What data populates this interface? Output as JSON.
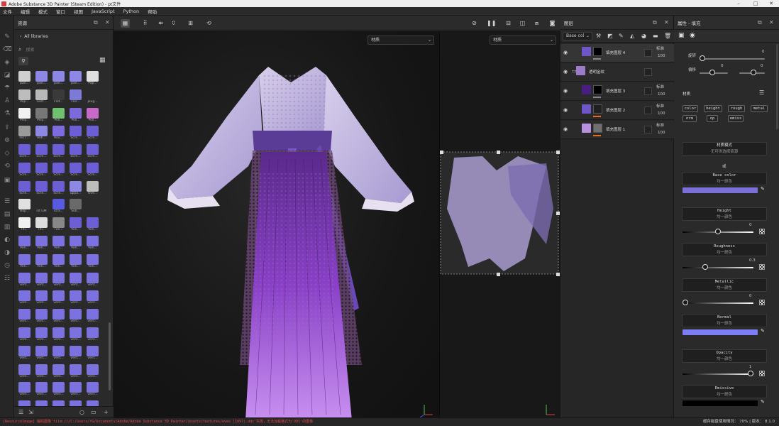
{
  "window": {
    "title": "Adobe Substance 3D Painter (Steam Edition) - pt文件",
    "min": "–",
    "max": "□",
    "close": "✕"
  },
  "menu": [
    "文件",
    "编辑",
    "模式",
    "窗口",
    "视图",
    "JavaScript",
    "Python",
    "帮助"
  ],
  "assets": {
    "title": "资源",
    "library": "All libraries",
    "search_placeholder": "搜索",
    "thumbs": [
      {
        "label": "pan...",
        "color": "#cfcfcf"
      },
      {
        "label": "pan...",
        "color": "#8d87e6"
      },
      {
        "label": "pan...",
        "color": "#8d87e6"
      },
      {
        "label": "pan...",
        "color": "#8d87e6"
      },
      {
        "label": "Pap...",
        "color": "#e0e0e0"
      },
      {
        "label": "Pap...",
        "color": "#bdbdbd"
      },
      {
        "label": "Fent...",
        "color": "#b8b8b8"
      },
      {
        "label": "Flat...",
        "color": "#3a3a3a"
      },
      {
        "label": "Flor...",
        "color": "#7c7ad8"
      },
      {
        "label": "plug...",
        "color": "#2a2a2a"
      },
      {
        "label": "Poly...",
        "color": "#f2f2f2"
      },
      {
        "label": "Poly...",
        "color": "#777777"
      },
      {
        "label": "Poli...",
        "color": "#6fc06f"
      },
      {
        "label": "Poli...",
        "color": "#7a6adb"
      },
      {
        "label": "Poli...",
        "color": "#c76ac7"
      },
      {
        "label": "rec7...",
        "color": "#9a9a9a"
      },
      {
        "label": "redl...",
        "color": "#8d87e6"
      },
      {
        "label": "Rou...",
        "color": "#7e6be0"
      },
      {
        "label": "Scre...",
        "color": "#6c5fd6"
      },
      {
        "label": "Scre...",
        "color": "#6c5fd6"
      },
      {
        "label": "Scre...",
        "color": "#6c5fd6"
      },
      {
        "label": "Scre...",
        "color": "#6c5fd6"
      },
      {
        "label": "Scre...",
        "color": "#6c5fd6"
      },
      {
        "label": "Scre...",
        "color": "#6c5fd6"
      },
      {
        "label": "Scre...",
        "color": "#6c5fd6"
      },
      {
        "label": "Scre...",
        "color": "#6c5fd6"
      },
      {
        "label": "Scre...",
        "color": "#6c5fd6"
      },
      {
        "label": "Scre...",
        "color": "#6c5fd6"
      },
      {
        "label": "Scre...",
        "color": "#6c5fd6"
      },
      {
        "label": "Scre...",
        "color": "#6c5fd6"
      },
      {
        "label": "Scre...",
        "color": "#6c5fd6"
      },
      {
        "label": "Scre...",
        "color": "#6c5fd6"
      },
      {
        "label": "Scre...",
        "color": "#6c5fd6"
      },
      {
        "label": "uppa...",
        "color": "#8d87e6"
      },
      {
        "label": "Ove...",
        "color": "#bdbdbd"
      },
      {
        "label": "slop...",
        "color": "#e0e0e0"
      },
      {
        "label": "slt GM",
        "color": "#2a2a2a"
      },
      {
        "label": "stra...",
        "color": "#5a5ae0"
      },
      {
        "label": "Sub...",
        "color": "#6a6a6a"
      },
      {
        "label": "",
        "color": "#2a2a2a"
      },
      {
        "label": "Thi...",
        "color": "#f0f0f0"
      },
      {
        "label": "Thi...",
        "color": "#dcdcdc"
      },
      {
        "label": "Tile...",
        "color": "#888888"
      },
      {
        "label": "Ven...",
        "color": "#6c5fd6"
      },
      {
        "label": "Ven...",
        "color": "#6c5fd6"
      },
      {
        "label": "Ven...",
        "color": "#7b72e0"
      },
      {
        "label": "Ven...",
        "color": "#7b72e0"
      },
      {
        "label": "Ven...",
        "color": "#7b72e0"
      },
      {
        "label": "Ven...",
        "color": "#7b72e0"
      },
      {
        "label": "Ven...",
        "color": "#7b72e0"
      },
      {
        "label": "Ven...",
        "color": "#7b72e0"
      },
      {
        "label": "Ven...",
        "color": "#7b72e0"
      },
      {
        "label": "Ven...",
        "color": "#7b72e0"
      },
      {
        "label": "Ven...",
        "color": "#7b72e0"
      },
      {
        "label": "Ven...",
        "color": "#7b72e0"
      },
      {
        "label": "vent...",
        "color": "#7b72e0"
      },
      {
        "label": "vent...",
        "color": "#7b72e0"
      },
      {
        "label": "vent...",
        "color": "#7b72e0"
      },
      {
        "label": "vent...",
        "color": "#7b72e0"
      },
      {
        "label": "vent...",
        "color": "#7b72e0"
      },
      {
        "label": "vent...",
        "color": "#7b72e0"
      },
      {
        "label": "vent...",
        "color": "#7b72e0"
      },
      {
        "label": "vent...",
        "color": "#7b72e0"
      },
      {
        "label": "vent...",
        "color": "#7b72e0"
      },
      {
        "label": "vent...",
        "color": "#7b72e0"
      },
      {
        "label": "vent...",
        "color": "#7b72e0"
      },
      {
        "label": "vent...",
        "color": "#7b72e0"
      },
      {
        "label": "vent...",
        "color": "#7b72e0"
      },
      {
        "label": "vent...",
        "color": "#7b72e0"
      },
      {
        "label": "vent...",
        "color": "#7b72e0"
      },
      {
        "label": "vent...",
        "color": "#7b72e0"
      },
      {
        "label": "vent...",
        "color": "#7b72e0"
      },
      {
        "label": "vent...",
        "color": "#7b72e0"
      },
      {
        "label": "vent...",
        "color": "#7b72e0"
      },
      {
        "label": "vent...",
        "color": "#7b72e0"
      },
      {
        "label": "vent...",
        "color": "#7b72e0"
      },
      {
        "label": "vent...",
        "color": "#7b72e0"
      },
      {
        "label": "vent...",
        "color": "#7b72e0"
      },
      {
        "label": "vent...",
        "color": "#7b72e0"
      },
      {
        "label": "vent...",
        "color": "#7b72e0"
      },
      {
        "label": "vent...",
        "color": "#7b72e0"
      },
      {
        "label": "vent...",
        "color": "#7b72e0"
      },
      {
        "label": "vent...",
        "color": "#7b72e0"
      },
      {
        "label": "vent...",
        "color": "#7b72e0"
      },
      {
        "label": "vent...",
        "color": "#7b72e0"
      },
      {
        "label": "vent...",
        "color": "#7b72e0"
      },
      {
        "label": "vent...",
        "color": "#7b72e0"
      },
      {
        "label": "vent...",
        "color": "#7b72e0"
      },
      {
        "label": "vent...",
        "color": "#7b72e0"
      },
      {
        "label": "vent...",
        "color": "#7b72e0"
      },
      {
        "label": "vent...",
        "color": "#7b72e0"
      },
      {
        "label": "vent...",
        "color": "#7b72e0"
      },
      {
        "label": "vent...",
        "color": "#7b72e0"
      },
      {
        "label": "vent...",
        "color": "#7b72e0"
      },
      {
        "label": "vent...",
        "color": "#7b72e0"
      }
    ]
  },
  "viewport": {
    "dropdown_3d": "材质",
    "dropdown_2d": "材质",
    "accent": "#8a4fd0"
  },
  "layers": {
    "title": "图层",
    "channel": "Base col",
    "rows": [
      {
        "name": "填充图层 4",
        "blend": "标准",
        "opacity": "100",
        "thumb": "#6e56c8",
        "mask": "#000000",
        "selected": true,
        "folder": false,
        "bar": "#888888"
      },
      {
        "name": "透明金纹",
        "blend": "",
        "opacity": "",
        "thumb": "#9c7cc8",
        "mask": "",
        "selected": false,
        "folder": true,
        "bar": ""
      },
      {
        "name": "填充图层 3",
        "blend": "标准",
        "opacity": "100",
        "thumb": "#4a1e80",
        "mask": "#000000",
        "selected": false,
        "folder": false,
        "bar": "#888888"
      },
      {
        "name": "填充图层 2",
        "blend": "标准",
        "opacity": "100",
        "thumb": "#6e56c8",
        "mask": "#202020",
        "selected": false,
        "folder": false,
        "bar": "#e07020"
      },
      {
        "name": "填充图层 1",
        "blend": "标准",
        "opacity": "100",
        "thumb": "#b890e0",
        "mask": "#707070",
        "selected": false,
        "folder": false,
        "bar": "#e07020"
      }
    ]
  },
  "props": {
    "title": "属性 - 填充",
    "rotate_label": "旋转",
    "rotate_value": "0",
    "offset_label": "偏移",
    "offset_x": "0",
    "offset_y": "0",
    "material_label": "材质",
    "chips": [
      "color",
      "height",
      "rough",
      "metal",
      "nrm",
      "op",
      "emiss"
    ],
    "mat_mode": "材质模式",
    "mat_mode_sub": "无可供选择资源",
    "or": "或",
    "channels": [
      {
        "name": "Base color",
        "sub": "均一颜色",
        "kind": "color",
        "color": "#7b6fd8",
        "value": ""
      },
      {
        "name": "Height",
        "sub": "均一颜色",
        "kind": "slider",
        "color": "",
        "value": "0",
        "level": 0.5
      },
      {
        "name": "Roughness",
        "sub": "均一颜色",
        "kind": "slider",
        "color": "",
        "value": "0.3",
        "level": 0.3
      },
      {
        "name": "Metallic",
        "sub": "均一颜色",
        "kind": "slider",
        "color": "",
        "value": "0",
        "level": 0.0
      },
      {
        "name": "Normal",
        "sub": "均一颜色",
        "kind": "color",
        "color": "#7d7df5",
        "value": ""
      },
      {
        "name": "Opacity",
        "sub": "均一颜色",
        "kind": "slider",
        "color": "",
        "value": "1",
        "level": 1.0
      },
      {
        "name": "Emissive",
        "sub": "均一颜色",
        "kind": "color",
        "color": "#000000",
        "value": ""
      }
    ]
  },
  "status": {
    "error": "[ResourceImage] 解码图像'file:///C:/Users/YG/Documents/Adobe/Adobe Substance 3D Painter/assets/textures/eves (1097).dds'失败，无法加载格式为'DDS'的图像",
    "memory_label": "缓存磁盘使用情况：",
    "memory_value": "70%",
    "version_label": "| 版本：",
    "version": "8.1.0"
  }
}
